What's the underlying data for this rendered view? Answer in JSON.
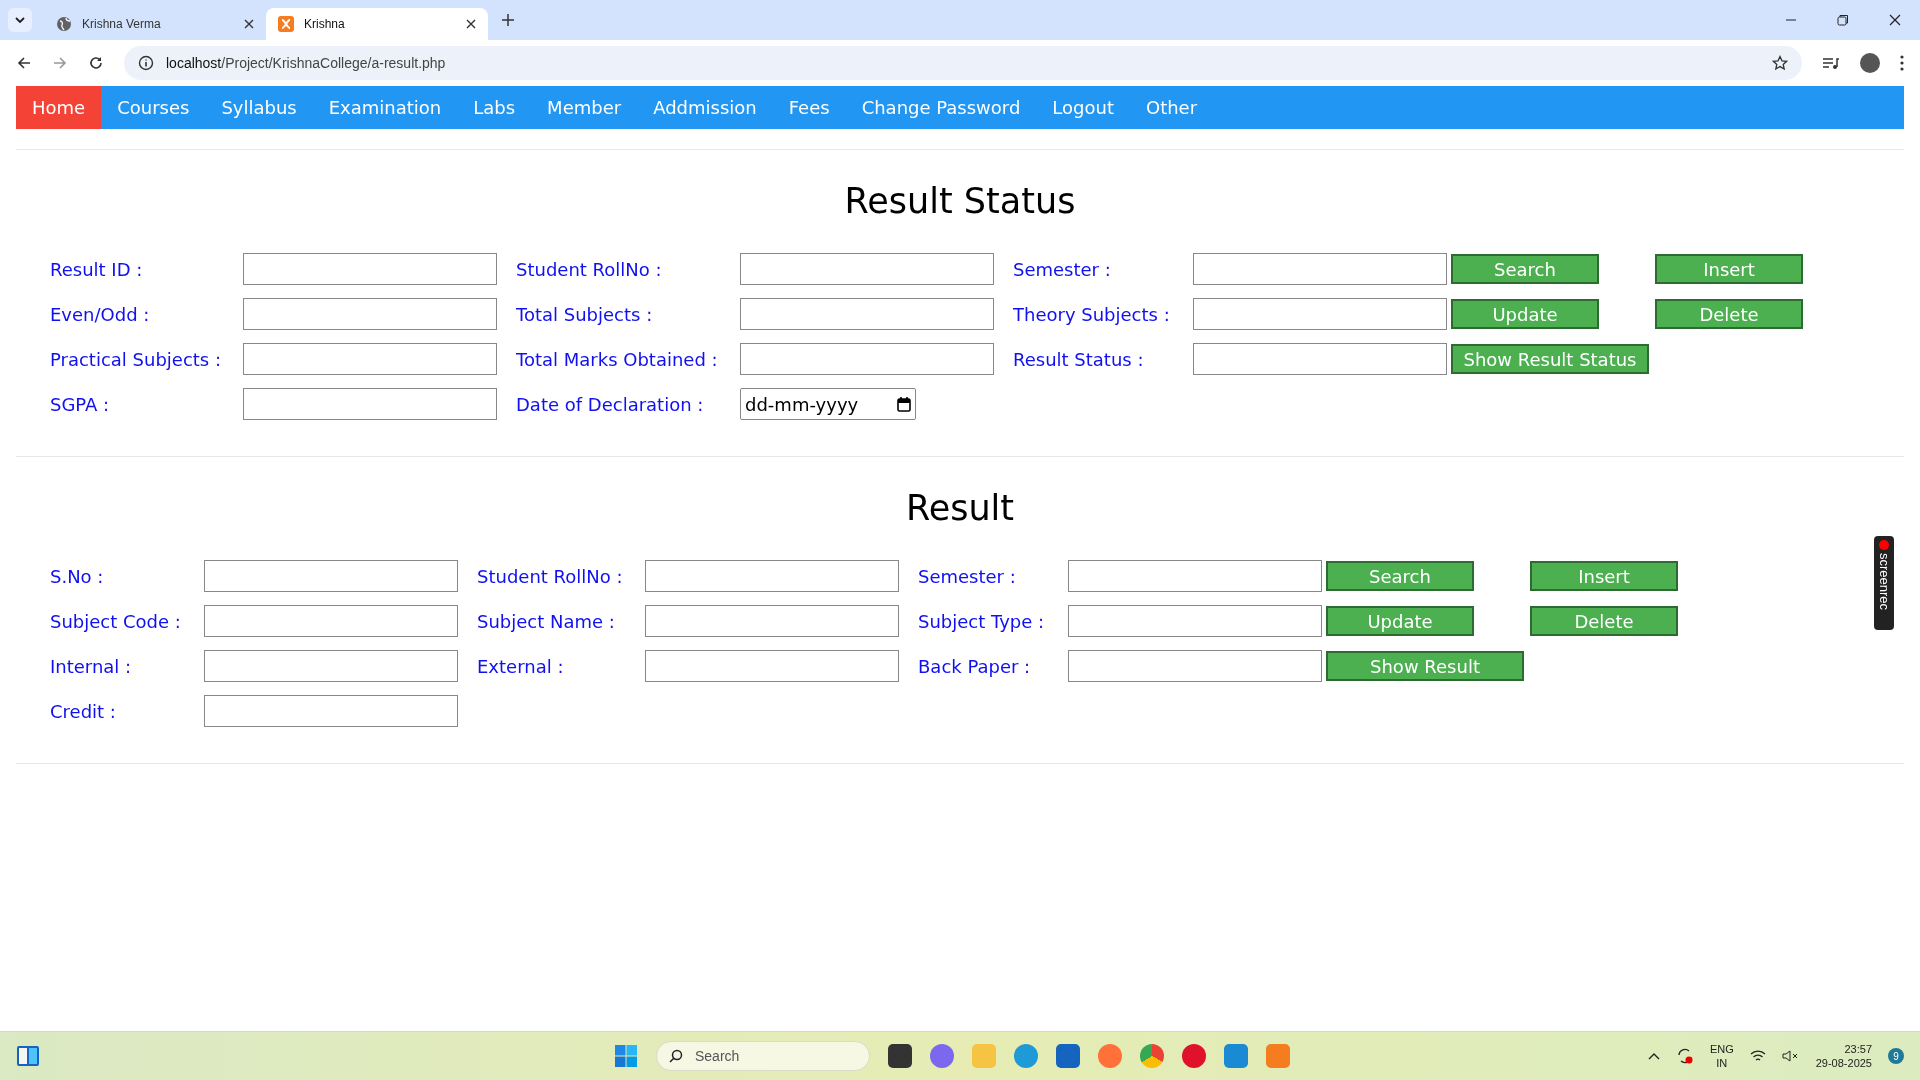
{
  "browser": {
    "tabs": [
      {
        "title": "Krishna Verma",
        "selected": false
      },
      {
        "title": "Krishna",
        "selected": true
      }
    ],
    "address": {
      "host": "localhost",
      "path": "/Project/KrishnaCollege/a-result.php"
    }
  },
  "nav": [
    {
      "label": "Home",
      "selected": true
    },
    {
      "label": "Courses",
      "selected": false
    },
    {
      "label": "Syllabus",
      "selected": false
    },
    {
      "label": "Examination",
      "selected": false
    },
    {
      "label": "Labs",
      "selected": false
    },
    {
      "label": "Member",
      "selected": false
    },
    {
      "label": "Addmission",
      "selected": false
    },
    {
      "label": "Fees",
      "selected": false
    },
    {
      "label": "Change Password",
      "selected": false
    },
    {
      "label": "Logout",
      "selected": false
    },
    {
      "label": "Other",
      "selected": false
    }
  ],
  "sections": [
    {
      "title": "Result Status",
      "rows": [
        [
          {
            "kind": "field",
            "label": "Result ID :"
          },
          {
            "kind": "field",
            "label": "Student RollNo :"
          },
          {
            "kind": "field",
            "label": "Semester :"
          },
          {
            "kind": "button",
            "label": "Search"
          },
          {
            "kind": "button",
            "label": "Insert"
          }
        ],
        [
          {
            "kind": "field",
            "label": "Even/Odd :"
          },
          {
            "kind": "field",
            "label": "Total Subjects :"
          },
          {
            "kind": "field",
            "label": "Theory Subjects :"
          },
          {
            "kind": "button",
            "label": "Update"
          },
          {
            "kind": "button",
            "label": "Delete"
          }
        ],
        [
          {
            "kind": "field",
            "label": "Practical Subjects :"
          },
          {
            "kind": "field",
            "label": "Total Marks Obtained :"
          },
          {
            "kind": "field",
            "label": "Result Status :"
          },
          {
            "kind": "button",
            "label": "Show Result Status"
          }
        ],
        [
          {
            "kind": "field",
            "label": "SGPA :"
          },
          {
            "kind": "date",
            "label": "Date of Declaration :",
            "placeholder": "dd-mm-yyyy"
          }
        ]
      ]
    },
    {
      "title": "Result",
      "rows": [
        [
          {
            "kind": "field",
            "label": "S.No :"
          },
          {
            "kind": "field",
            "label": "Student RollNo :"
          },
          {
            "kind": "field",
            "label": "Semester :"
          },
          {
            "kind": "button",
            "label": "Search"
          },
          {
            "kind": "button",
            "label": "Insert"
          }
        ],
        [
          {
            "kind": "field",
            "label": "Subject Code :"
          },
          {
            "kind": "field",
            "label": "Subject Name :"
          },
          {
            "kind": "field",
            "label": "Subject Type :"
          },
          {
            "kind": "button",
            "label": "Update"
          },
          {
            "kind": "button",
            "label": "Delete"
          }
        ],
        [
          {
            "kind": "field",
            "label": "Internal :"
          },
          {
            "kind": "field",
            "label": "External :"
          },
          {
            "kind": "field",
            "label": "Back Paper :"
          },
          {
            "kind": "button",
            "label": "Show Result"
          }
        ],
        [
          {
            "kind": "field",
            "label": "Credit :"
          }
        ]
      ]
    }
  ],
  "recorder_badge": "screenrec",
  "taskbar": {
    "search": "Search",
    "language": "ENG",
    "region": "IN",
    "time": "23:57",
    "date": "29-08-2025",
    "notifications": "9"
  }
}
